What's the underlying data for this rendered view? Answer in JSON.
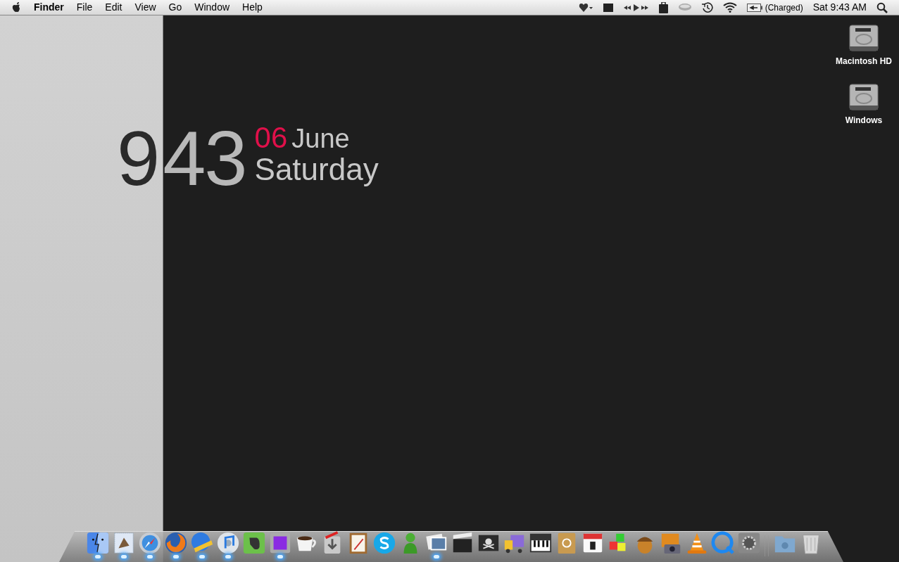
{
  "menu_bar": {
    "app": "Finder",
    "menus": [
      "File",
      "Edit",
      "View",
      "Go",
      "Window",
      "Help"
    ],
    "battery_status": "(Charged)",
    "clock": "Sat 9:43 AM"
  },
  "clock_widget": {
    "hour": "9",
    "minutes": "43",
    "day": "06",
    "month": "June",
    "weekday": "Saturday"
  },
  "desktop_icons": [
    {
      "label": "Macintosh HD"
    },
    {
      "label": "Windows"
    }
  ],
  "dock": {
    "items": [
      {
        "kind": "finder",
        "running": true
      },
      {
        "kind": "mail",
        "running": true
      },
      {
        "kind": "safari",
        "running": true
      },
      {
        "kind": "firefox",
        "running": true
      },
      {
        "kind": "globe",
        "running": true
      },
      {
        "kind": "itunes",
        "running": true
      },
      {
        "kind": "evernote",
        "running": false
      },
      {
        "kind": "purple",
        "running": true
      },
      {
        "kind": "coffee",
        "running": false
      },
      {
        "kind": "installer",
        "running": false
      },
      {
        "kind": "notepad",
        "running": false
      },
      {
        "kind": "skype",
        "running": false
      },
      {
        "kind": "figure",
        "running": false
      },
      {
        "kind": "photos",
        "running": true
      },
      {
        "kind": "clapper",
        "running": false
      },
      {
        "kind": "pirate",
        "running": false
      },
      {
        "kind": "truck",
        "running": false
      },
      {
        "kind": "piano",
        "running": false
      },
      {
        "kind": "addressbook",
        "running": false
      },
      {
        "kind": "calendar",
        "running": false
      },
      {
        "kind": "cubes",
        "running": false
      },
      {
        "kind": "acorn",
        "running": false
      },
      {
        "kind": "camera",
        "running": false
      },
      {
        "kind": "cone",
        "running": false
      },
      {
        "kind": "quicktime",
        "running": false
      },
      {
        "kind": "prefs",
        "running": false
      },
      {
        "kind": "separator"
      },
      {
        "kind": "folder",
        "running": false
      },
      {
        "kind": "trash",
        "running": false
      }
    ]
  }
}
